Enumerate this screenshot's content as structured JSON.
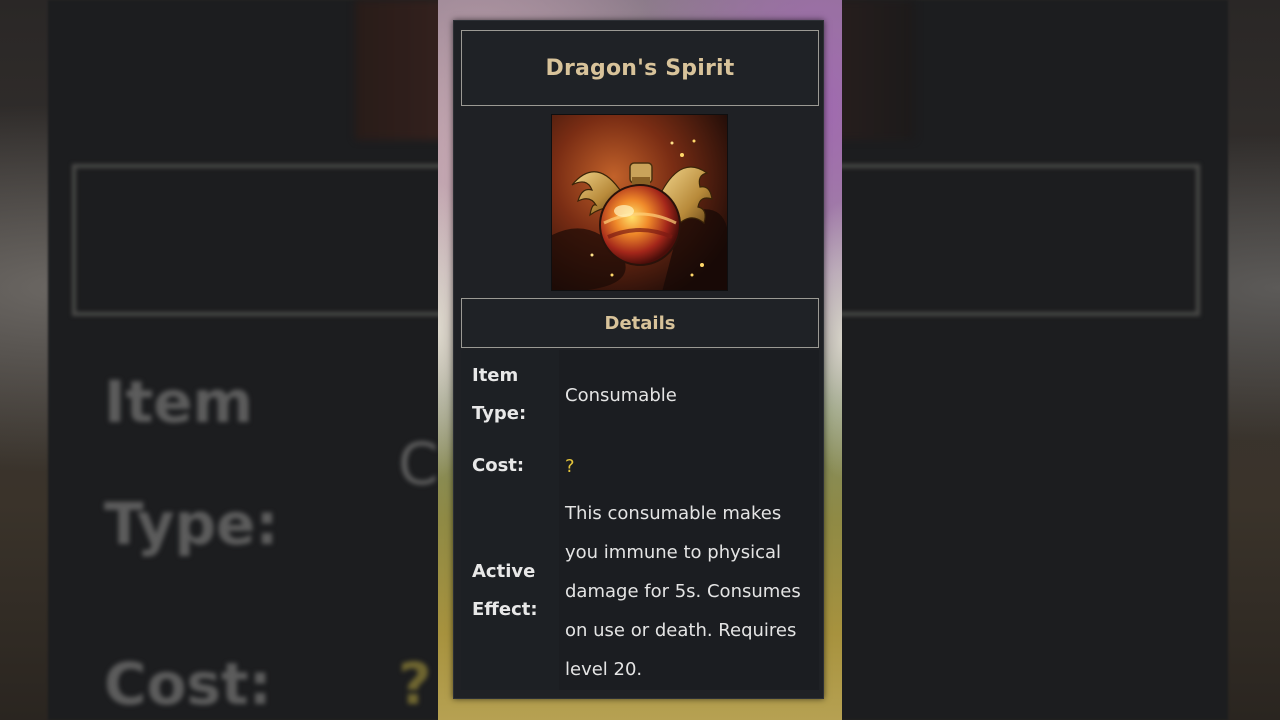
{
  "item": {
    "name": "Dragon's Spirit",
    "details_header": "Details",
    "icon": "dragon-winged-potion-icon"
  },
  "details": {
    "item_type_label": "Item Type:",
    "item_type_value": "Consumable",
    "cost_label": "Cost:",
    "cost_value": "?",
    "active_effect_label": "Active Effect:",
    "active_effect_value": "This consumable makes you immune to physical damage for 5s. Consumes on use or death. Requires level 20."
  },
  "background_echo": {
    "item_label": "Item",
    "type_label": "Type:",
    "cost_label": "Cost:",
    "cost_value": "?",
    "value_fragment": "C"
  },
  "colors": {
    "title_gold": "#d8c39a",
    "cost_yellow": "#e3c33a",
    "panel_bg": "#1f2125",
    "frame_border": "#9b9a94"
  }
}
